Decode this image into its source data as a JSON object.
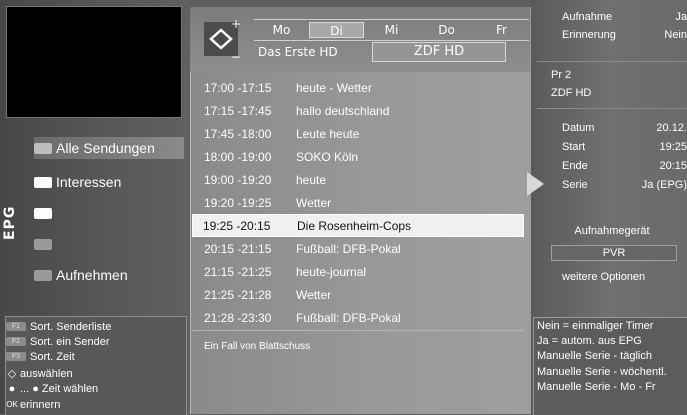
{
  "left": {
    "epg_label": "EPG",
    "menu": [
      {
        "label": "Alle Sendungen",
        "color": "#bdbdbd",
        "selected": true
      },
      {
        "label": "Interessen",
        "color": "#ffffff",
        "selected": false
      },
      {
        "label": "",
        "color": "#ffffff",
        "selected": false
      },
      {
        "label": "",
        "color": "#9a9a9a",
        "selected": false
      },
      {
        "label": "Aufnehmen",
        "color": "#9a9a9a",
        "selected": false
      }
    ],
    "help": [
      {
        "key": "F1",
        "text": "Sort. Senderliste"
      },
      {
        "key": "F2",
        "text": "Sort. ein Sender"
      },
      {
        "key": "F3",
        "text": "Sort. Zeit"
      },
      {
        "glyph": "◇",
        "text": "auswählen"
      },
      {
        "glyph": "●",
        "text": "... ● Zeit wählen"
      },
      {
        "glyph": "OK",
        "text": "erinnern"
      }
    ]
  },
  "header": {
    "days": [
      {
        "label": "Mo",
        "selected": false
      },
      {
        "label": "Di",
        "selected": true
      },
      {
        "label": "Mi",
        "selected": false
      },
      {
        "label": "Do",
        "selected": false
      },
      {
        "label": "Fr",
        "selected": false
      }
    ],
    "prev_channel": "Das Erste HD",
    "current_channel": "ZDF HD"
  },
  "programs": [
    {
      "time": "17:00 -17:15",
      "title": "heute - Wetter",
      "selected": false
    },
    {
      "time": "17:15 -17:45",
      "title": "hallo deutschland",
      "selected": false
    },
    {
      "time": "17:45 -18:00",
      "title": "Leute heute",
      "selected": false
    },
    {
      "time": "18:00 -19:00",
      "title": "SOKO Köln",
      "selected": false
    },
    {
      "time": "19:00 -19:20",
      "title": "heute",
      "selected": false
    },
    {
      "time": "19:20 -19:25",
      "title": "Wetter",
      "selected": false
    },
    {
      "time": "19:25 -20:15",
      "title": "Die Rosenheim-Cops",
      "selected": true
    },
    {
      "time": "20:15 -21:15",
      "title": "Fußball: DFB-Pokal",
      "selected": false
    },
    {
      "time": "21:15 -21:25",
      "title": "heute-journal",
      "selected": false
    },
    {
      "time": "21:25 -21:28",
      "title": "Wetter",
      "selected": false
    },
    {
      "time": "21:28 -23:30",
      "title": "Fußball: DFB-Pokal",
      "selected": false
    }
  ],
  "program_description": "Ein Fall von Blattschuss",
  "right": {
    "recording": {
      "label": "Aufnahme",
      "value": "Ja"
    },
    "reminder": {
      "label": "Erinnerung",
      "value": "Nein"
    },
    "program_number": "Pr  2",
    "channel": "ZDF HD",
    "date": {
      "label": "Datum",
      "value": "20.12."
    },
    "start": {
      "label": "Start",
      "value": "19:25"
    },
    "end": {
      "label": "Ende",
      "value": "20:15"
    },
    "series": {
      "label": "Serie",
      "value": "Ja (EPG)"
    },
    "recording_device_label": "Aufnahmegerät",
    "recording_device_value": "PVR",
    "more_options": "weitere Optionen",
    "legend": [
      "Nein = einmaliger Timer",
      "Ja = autom. aus EPG",
      "Manuelle Serie - täglich",
      "Manuelle Serie - wöchentl.",
      "Manuelle Serie - Mo - Fr"
    ]
  }
}
